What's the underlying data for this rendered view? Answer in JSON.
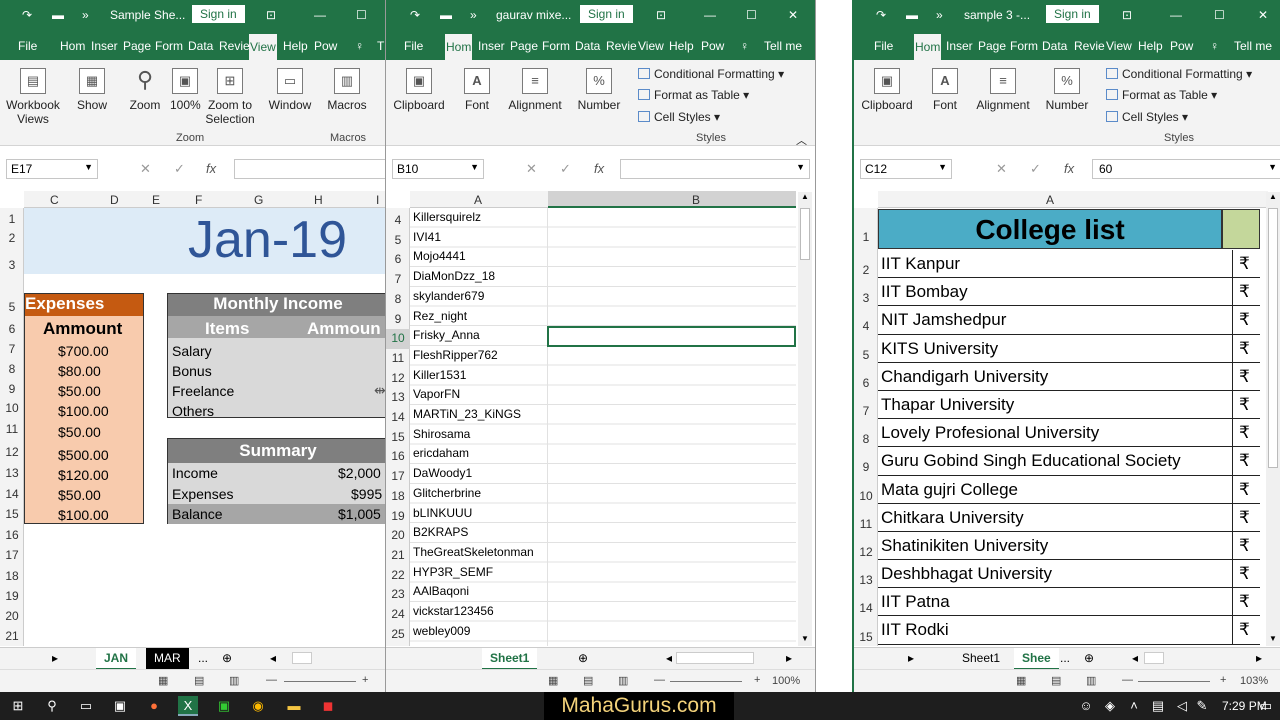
{
  "colors": {
    "excel_green": "#217346",
    "expenses_header": "#c55a11",
    "expenses_fill": "#f8cbad",
    "income_header": "#7f7f7f",
    "income_fill": "#d9d9d9",
    "month_bg": "#ddebf7",
    "month_text": "#2f5597",
    "college_header": "#4bacc6"
  },
  "w1": {
    "title": "Sample She...",
    "signin": "Sign in",
    "tabs": [
      "File",
      "Hom",
      "Inser",
      "Page",
      "Form",
      "Data",
      "Revie",
      "View",
      "Help",
      "Pow",
      "T"
    ],
    "ribbon": {
      "workbook_views": "Workbook Views",
      "show": "Show",
      "zoom": "Zoom",
      "zoom100": "100%",
      "zoom_sel": "Zoom to Selection",
      "window": "Window",
      "macros": "Macros",
      "grp_zoom": "Zoom",
      "grp_macros": "Macros"
    },
    "namebox": "E17",
    "fx": "fx",
    "cols": [
      "C",
      "D",
      "E",
      "F",
      "G",
      "H",
      "I"
    ],
    "rows": [
      "1",
      "2",
      "3",
      "5",
      "6",
      "7",
      "8",
      "9",
      "10",
      "11",
      "12",
      "13",
      "14",
      "15",
      "16",
      "17",
      "18",
      "19",
      "20",
      "21"
    ],
    "month": "Jan-19",
    "expenses_title": "Expenses",
    "ammount": "Ammount",
    "expenses": [
      "$700.00",
      "$80.00",
      "$50.00",
      "$100.00",
      "$50.00",
      "$500.00",
      "$120.00",
      "$50.00",
      "$100.00"
    ],
    "income_title": "Monthly Income",
    "items": "Items",
    "amount_hdr": "Ammoun",
    "income_items": [
      "Salary",
      "Bonus",
      "Freelance",
      "Others"
    ],
    "summary_title": "Summary",
    "summary": [
      {
        "label": "Income",
        "value": "$2,000"
      },
      {
        "label": "Expenses",
        "value": "$995"
      },
      {
        "label": "Balance",
        "value": "$1,005"
      }
    ],
    "sheets": [
      "JAN",
      "MAR",
      "..."
    ]
  },
  "w2": {
    "title": "gaurav mixe...",
    "signin": "Sign in",
    "tabs": [
      "File",
      "Hom",
      "Inser",
      "Page",
      "Form",
      "Data",
      "Revie",
      "View",
      "Help",
      "Pow",
      "Tell me"
    ],
    "ribbon": {
      "clipboard": "Clipboard",
      "font": "Font",
      "alignment": "Alignment",
      "number": "Number",
      "cond": "Conditional Formatting",
      "fmt_table": "Format as Table",
      "cell_styles": "Cell Styles",
      "grp_styles": "Styles"
    },
    "namebox": "B10",
    "fx": "fx",
    "cols": [
      "A",
      "B"
    ],
    "rows": [
      "4",
      "5",
      "6",
      "7",
      "8",
      "9",
      "10",
      "11",
      "12",
      "13",
      "14",
      "15",
      "16",
      "17",
      "18",
      "19",
      "20",
      "21",
      "22",
      "23",
      "24",
      "25"
    ],
    "names": [
      "Killersquirelz",
      "IVI41",
      "Mojo4441",
      "DiaMonDzz_18",
      "skylander679",
      "Rez_night",
      "Frisky_Anna",
      "FleshRipper762",
      "Killer1531",
      "VaporFN",
      "MARTiN_23_KiNGS",
      "Shirosama",
      "ericdaham",
      "DaWoody1",
      "Glitcherbrine",
      "bLINKUUU",
      "B2KRAPS",
      "TheGreatSkeletonman",
      "HYP3R_SEMF",
      "AAlBaqoni",
      "vickstar123456",
      "webley009"
    ],
    "sheets": [
      "Sheet1"
    ],
    "zoom": "100%"
  },
  "w3": {
    "title": "sample 3 -...",
    "signin": "Sign in",
    "tabs": [
      "File",
      "Hom",
      "Inser",
      "Page",
      "Form",
      "Data",
      "Revie",
      "View",
      "Help",
      "Pow",
      "Tell me"
    ],
    "ribbon": {
      "clipboard": "Clipboard",
      "font": "Font",
      "alignment": "Alignment",
      "number": "Number",
      "cond": "Conditional Formatting",
      "fmt_table": "Format as Table",
      "cell_styles": "Cell Styles",
      "grp_styles": "Styles"
    },
    "namebox": "C12",
    "fx": "fx",
    "formula": "60",
    "cols": [
      "A"
    ],
    "rows": [
      "1",
      "2",
      "3",
      "4",
      "5",
      "6",
      "7",
      "8",
      "9",
      "10",
      "11",
      "12",
      "13",
      "14",
      "15"
    ],
    "college_title": "College list",
    "colleges": [
      "IIT Kanpur",
      "IIT Bombay",
      "NIT Jamshedpur",
      "KITS University",
      "Chandigarh University",
      "Thapar University",
      "Lovely Profesional University",
      "Guru Gobind Singh Educational Society",
      "Mata gujri College",
      "Chitkara University",
      "Shatinikiten University",
      "Deshbhagat University",
      "IIT Patna",
      "IIT Rodki"
    ],
    "rupee": "₹",
    "sheets": [
      "Sheet1",
      "Shee",
      "..."
    ],
    "zoom": "103%"
  },
  "taskbar": {
    "watermark": "MahaGurus.com",
    "time": "7:29 PM"
  }
}
